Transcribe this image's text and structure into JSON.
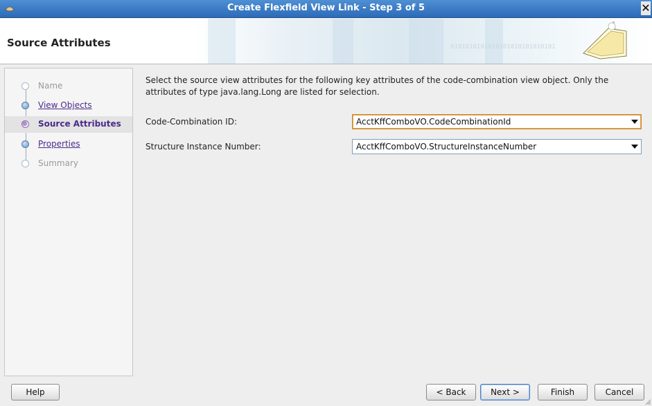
{
  "window": {
    "title": "Create Flexfield View Link - Step 3 of 5",
    "close_glyph": "✕"
  },
  "header": {
    "page_title": "Source Attributes",
    "binary_decoration": "0101010101010101010101010101",
    "icon": "wizard-folder-icon"
  },
  "nav": {
    "steps": [
      {
        "label": "Name",
        "state": "disabled"
      },
      {
        "label": "View Objects",
        "state": "visited"
      },
      {
        "label": "Source Attributes",
        "state": "current"
      },
      {
        "label": "Properties",
        "state": "visited"
      },
      {
        "label": "Summary",
        "state": "disabled"
      }
    ]
  },
  "content": {
    "description": "Select the source view attributes for the following key attributes of the code-combination view object. Only the attributes of type java.lang.Long are listed for selection.",
    "fields": [
      {
        "label": "Code-Combination ID:",
        "value": "AcctKffComboVO.CodeCombinationId"
      },
      {
        "label": "Structure Instance Number:",
        "value": "AcctKffComboVO.StructureInstanceNumber"
      }
    ]
  },
  "buttons": {
    "help": "Help",
    "back": "< Back",
    "next": "Next >",
    "finish": "Finish",
    "cancel": "Cancel"
  },
  "colors": {
    "titlebar": "#2c6bb8",
    "link": "#4b2b8a",
    "focus": "#c88a2d"
  }
}
